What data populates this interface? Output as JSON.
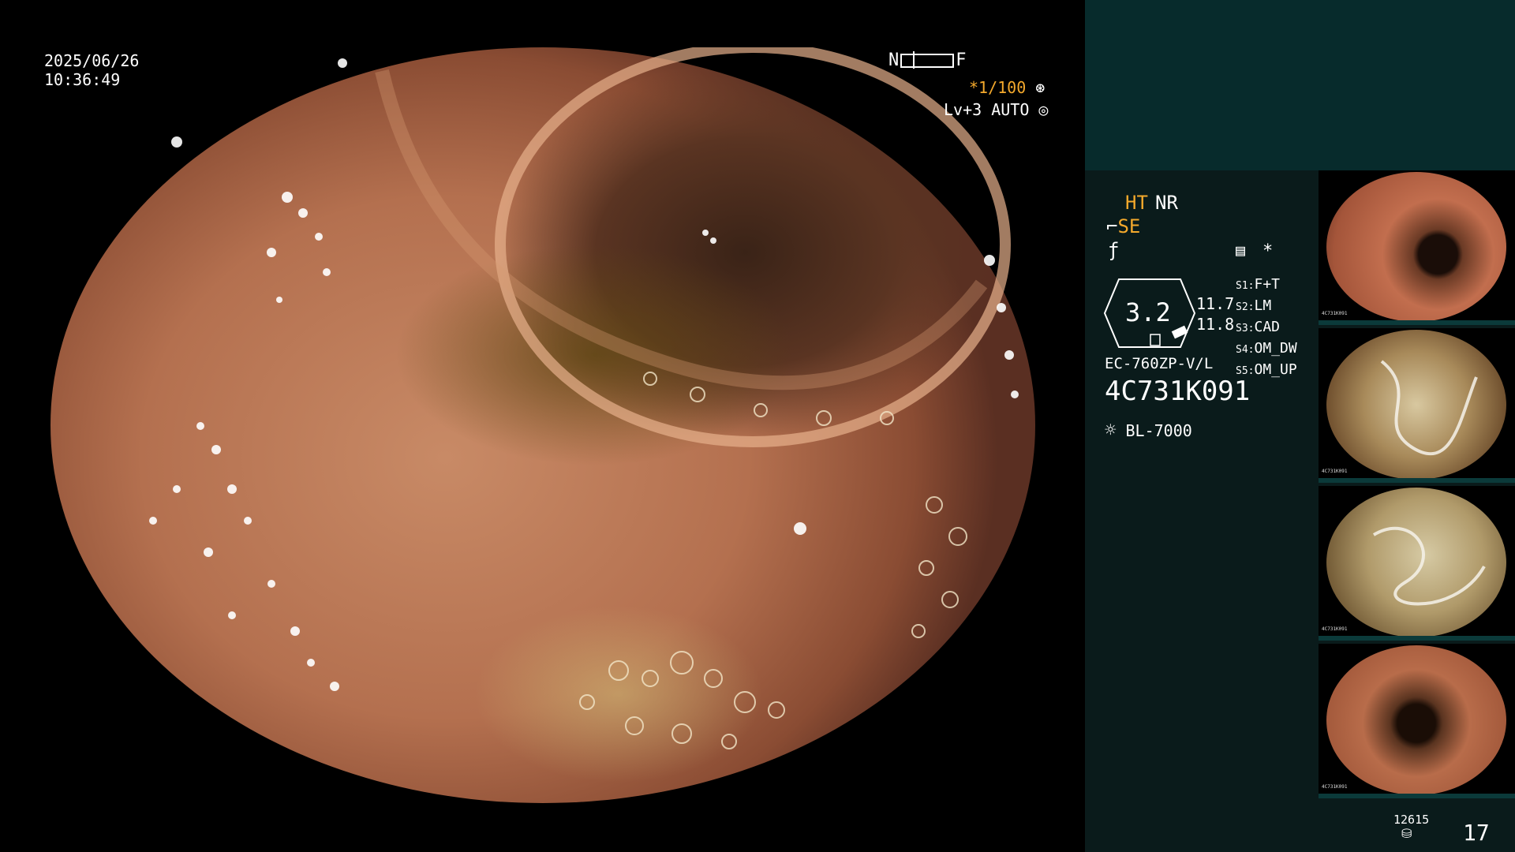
{
  "overlay": {
    "date": "2025/06/26",
    "time": "10:36:49",
    "nf_left": "N",
    "nf_right": "F",
    "shutter": "*1/100",
    "level": "Lv+3 AUTO"
  },
  "panel": {
    "mode_ht": "HT",
    "mode_nr": "NR",
    "mode_se": "SE",
    "star": "*",
    "zoom": "3.2",
    "val1": "11.7",
    "val2": "11.8",
    "scope_model": "EC-760ZP-V/L",
    "serial": "4C731K091",
    "light": "BL-7000",
    "switches": [
      {
        "key": "S1:",
        "val": "F+T"
      },
      {
        "key": "S2:",
        "val": "LM"
      },
      {
        "key": "S3:",
        "val": "CAD"
      },
      {
        "key": "S4:",
        "val": "OM_DW"
      },
      {
        "key": "S5:",
        "val": "OM_UP"
      }
    ],
    "storage_count": "12615",
    "frame_count": "17"
  },
  "thumbnails": [
    {
      "label": "4C731K091"
    },
    {
      "label": "4C731K091"
    },
    {
      "label": "4C731K091"
    },
    {
      "label": "4C731K091"
    }
  ],
  "colors": {
    "background": "#000000",
    "panel_top": "#072b2c",
    "panel_body": "#0a1b1b",
    "accent_amber": "#f4a92c",
    "text": "#ffffff"
  },
  "icons": [
    "aperture-icon",
    "auto-iris-icon",
    "mode-se-icon",
    "enhance-icon",
    "memory-card-icon",
    "light-source-icon",
    "storage-icon"
  ]
}
